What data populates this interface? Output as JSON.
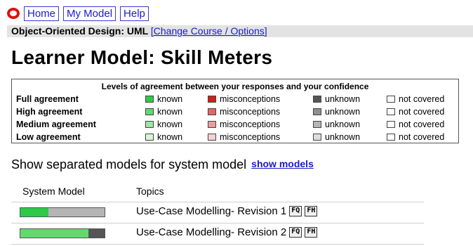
{
  "nav": {
    "home_label": "Home",
    "mymodel_label": "My Model",
    "help_label": "Help"
  },
  "course": {
    "name": "Object-Oriented Design: UML",
    "link_label": "[Change Course / Options]"
  },
  "page_title": "Learner Model: Skill Meters",
  "legend": {
    "title": "Levels of agreement between your responses and your confidence",
    "items": [
      "known",
      "misconceptions",
      "unknown",
      "not covered"
    ],
    "rows": [
      {
        "level": "Full agreement",
        "colors": [
          "#2fc94a",
          "#d91a1a",
          "#555555",
          "#ffffff"
        ]
      },
      {
        "level": "High agreement",
        "colors": [
          "#63d86f",
          "#e06767",
          "#8f8f8f",
          "#ffffff"
        ]
      },
      {
        "level": "Medium agreement",
        "colors": [
          "#9fe6a4",
          "#eb9c9c",
          "#b5b5b5",
          "#ffffff"
        ]
      },
      {
        "level": "Low agreement",
        "colors": [
          "#d8f5d9",
          "#f6d2d2",
          "#dddddd",
          "#ffffff"
        ]
      }
    ]
  },
  "separated": {
    "text": "Show separated models for system model",
    "link_label": "show models"
  },
  "table": {
    "col_system_model": "System Model",
    "col_topics": "Topics",
    "rows": [
      {
        "topic": "Use-Case Modelling- Revision 1",
        "meter": [
          {
            "fraction": 0.33,
            "color": "#2fc94a"
          },
          {
            "fraction": 0.67,
            "color": "#b5b5b5"
          }
        ]
      },
      {
        "topic": "Use-Case Modelling- Revision 2",
        "meter": [
          {
            "fraction": 0.81,
            "color": "#63d86f"
          },
          {
            "fraction": 0.19,
            "color": "#555555"
          }
        ]
      }
    ],
    "tag_fq": "FQ",
    "tag_fh": "FH"
  }
}
